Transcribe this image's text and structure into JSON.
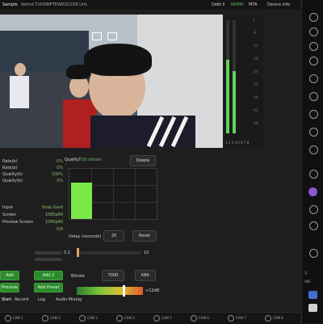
{
  "topbar": {
    "sample_label": "Sample",
    "device_label": "Selmd TVOOMPTEW02O2D8 Urls",
    "stat1": "Debt.li",
    "stat2": "NOMO",
    "stat3": "MTA",
    "stat4": "Device info"
  },
  "meters": {
    "ticks": [
      "0",
      "-6",
      "-12",
      "-18",
      "-24",
      "-30",
      "-36",
      "-42",
      "-48"
    ],
    "labels": "1 2 3 4 5 6 7 8",
    "left_level": 0.65,
    "right_level": 0.55
  },
  "rows": [
    {
      "label": "Rate(b)",
      "value": "0%"
    },
    {
      "label": "Rate(b)",
      "value": "0%"
    },
    {
      "label": "Quality(b)",
      "value": "100%"
    },
    {
      "label": "Quality(b)",
      "value": "0%"
    },
    {
      "label": "Input",
      "value": "Hosp Gard"
    },
    {
      "label": "Screen",
      "value": "1080p60"
    },
    {
      "label": "Preview Screen",
      "value": "1080p60"
    },
    {
      "label": "",
      "value": "0/4"
    }
  ],
  "chart_block": {
    "title": "Quality",
    "subtitle": "TDD bitrate",
    "button": "Delete"
  },
  "chart_data": {
    "type": "bar",
    "categories": [
      "1"
    ],
    "values": [
      0.72
    ],
    "ylim": [
      0,
      1
    ]
  },
  "delay": {
    "label": "Delay (seconds)",
    "value": "20",
    "button": "Reset"
  },
  "buttons": {
    "green1": "Add",
    "green2": "Add 2",
    "green3": "Preview",
    "green4": "Add Preset",
    "bitrate": "7000",
    "bitrate_unit": "KBit",
    "bitrate_label": "Bitrate"
  },
  "slider_labels": {
    "s1": "0.2",
    "s1_end": "10",
    "s2_end": "+12dB"
  },
  "tabs": [
    "Start",
    "Record",
    "Log",
    "Audio Mixing"
  ],
  "status_items": [
    "CAM 1",
    "CAM 2",
    "CAM 3",
    "CAM 4",
    "CAM 5",
    "CAM 6",
    "CAM 7",
    "CAM 8"
  ],
  "rail": {
    "label1": "Ti",
    "label2": "ABC"
  },
  "colors": {
    "accent_green": "#62d25a",
    "button_green": "#2d8a2d",
    "bar_green": "#7be84a"
  }
}
